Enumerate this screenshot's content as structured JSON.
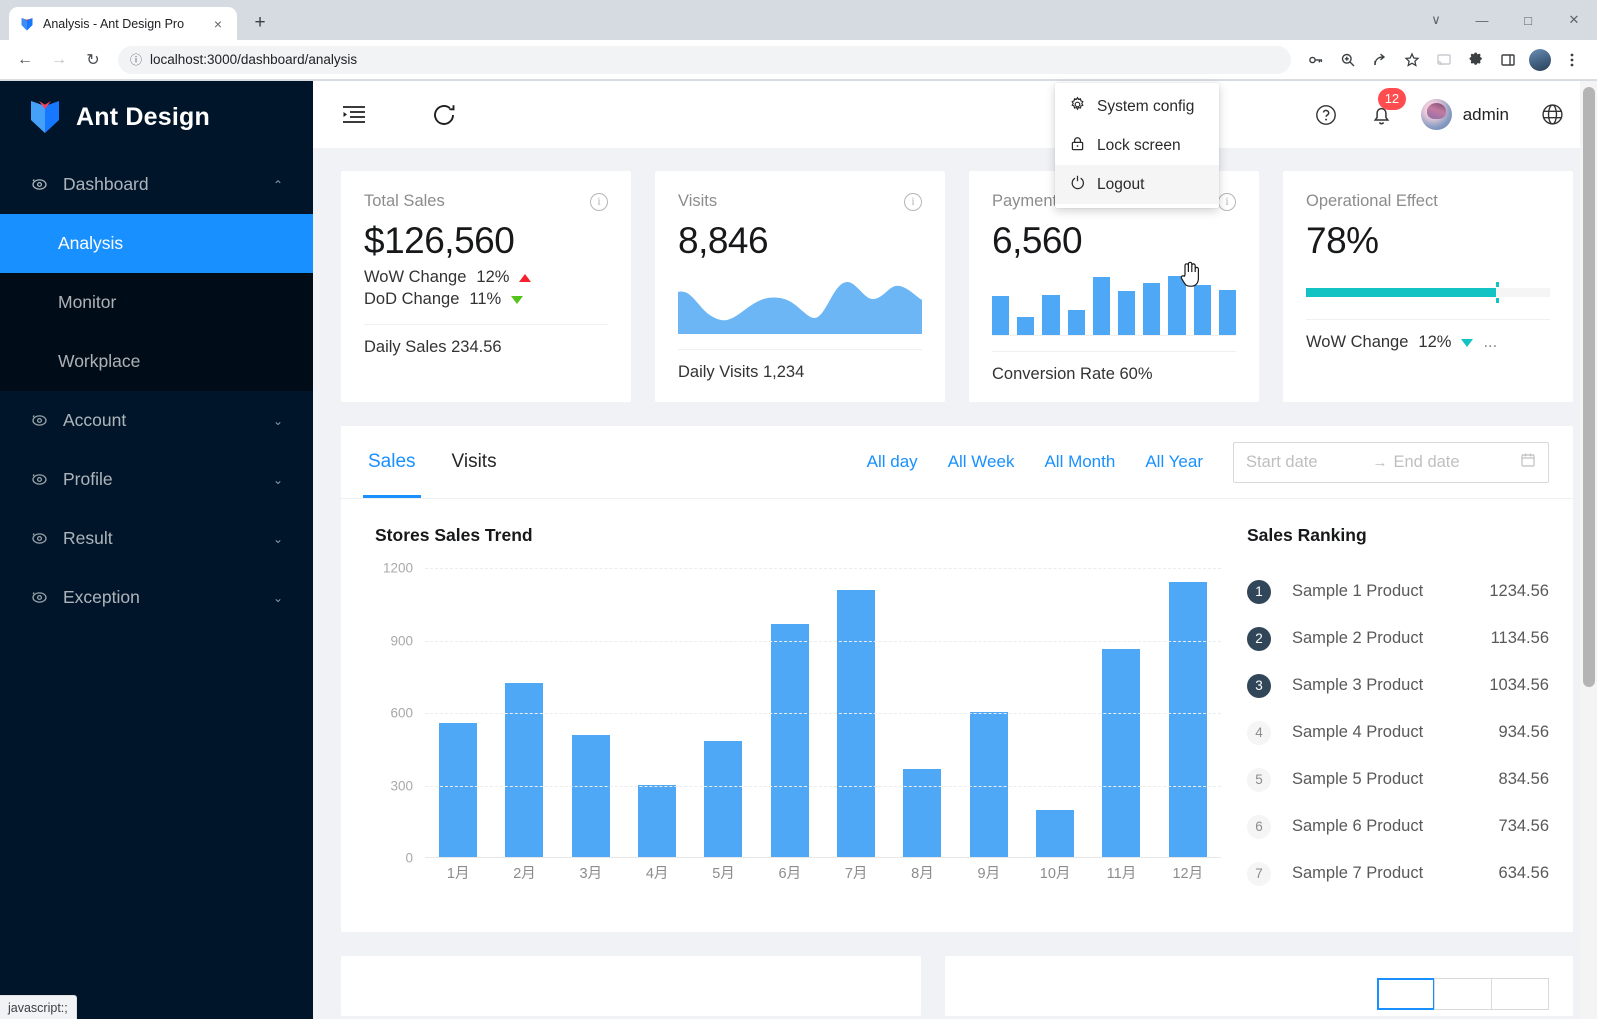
{
  "browser": {
    "tab_title": "Analysis - Ant Design Pro",
    "tab_close": "×",
    "new_tab": "+",
    "window_controls": [
      "∨",
      "—",
      "□",
      "✕"
    ],
    "back": "←",
    "forward": "→",
    "reload": "↻",
    "info_icon": "ⓘ",
    "url": "localhost:3000/dashboard/analysis",
    "toolbar_icons": [
      "key-icon",
      "zoom-icon",
      "share-icon",
      "star-icon",
      "cast-icon",
      "extensions-icon",
      "sidepanel-icon",
      "profile-avatar",
      "chrome-menu-icon"
    ],
    "status_text": "javascript:;"
  },
  "sidebar": {
    "brand": "Ant Design",
    "items": [
      {
        "label": "Dashboard",
        "icon": "eye-icon",
        "caret": "⌃",
        "expanded": true
      },
      {
        "label": "Account",
        "icon": "eye-icon",
        "caret": "⌄",
        "expanded": false
      },
      {
        "label": "Profile",
        "icon": "eye-icon",
        "caret": "⌄",
        "expanded": false
      },
      {
        "label": "Result",
        "icon": "eye-icon",
        "caret": "⌄",
        "expanded": false
      },
      {
        "label": "Exception",
        "icon": "eye-icon",
        "caret": "⌄",
        "expanded": false
      }
    ],
    "submenu": [
      {
        "label": "Analysis",
        "active": true
      },
      {
        "label": "Monitor",
        "active": false
      },
      {
        "label": "Workplace",
        "active": false
      }
    ],
    "active_color": "#1890ff",
    "bg_color": "#001529"
  },
  "header": {
    "menu_fold_icon": "menu-fold-icon",
    "refresh_icon": "refresh-icon",
    "help_icon": "question-circle-icon",
    "bell_icon": "bell-icon",
    "notification_count": "12",
    "notification_color": "#ff4d4f",
    "user_name": "admin",
    "globe_icon": "globe-icon"
  },
  "dropdown": {
    "items": [
      {
        "label": "System config",
        "icon": "gear-icon",
        "hover": false
      },
      {
        "label": "Lock screen",
        "icon": "lock-icon",
        "hover": false
      },
      {
        "label": "Logout",
        "icon": "logout-icon",
        "hover": true
      }
    ]
  },
  "cards": [
    {
      "title": "Total Sales",
      "value": "$126,560",
      "trends": [
        {
          "label": "WoW Change",
          "value": "12%",
          "dir": "up"
        },
        {
          "label": "DoD Change",
          "value": "11%",
          "dir": "down"
        }
      ],
      "footer": "Daily Sales 234.56",
      "visual": "none"
    },
    {
      "title": "Visits",
      "value": "8,846",
      "footer": "Daily Visits 1,234",
      "visual": "area"
    },
    {
      "title": "Payments",
      "value": "6,560",
      "footer": "Conversion Rate 60%",
      "visual": "bars"
    },
    {
      "title": "Operational Effect",
      "value": "78%",
      "footer": "WoW Change",
      "footer_value": "12%",
      "footer_dir": "down",
      "footer_more": "...",
      "visual": "progress",
      "progress": 78,
      "progress_color": "#13c2c2"
    }
  ],
  "panel": {
    "tabs": [
      {
        "label": "Sales",
        "active": true
      },
      {
        "label": "Visits",
        "active": false
      }
    ],
    "quick_links": [
      "All day",
      "All Week",
      "All Month",
      "All Year"
    ],
    "date_start_placeholder": "Start date",
    "date_end_placeholder": "End date",
    "date_sep": "→",
    "calendar_icon": "calendar-icon",
    "chart_heading": "Stores Sales Trend",
    "rank_heading": "Sales Ranking",
    "ranking": [
      {
        "rank": "1",
        "name": "Sample 1 Product",
        "value": "1234.56"
      },
      {
        "rank": "2",
        "name": "Sample 2 Product",
        "value": "1134.56"
      },
      {
        "rank": "3",
        "name": "Sample 3 Product",
        "value": "1034.56"
      },
      {
        "rank": "4",
        "name": "Sample 4 Product",
        "value": "934.56"
      },
      {
        "rank": "5",
        "name": "Sample 5 Product",
        "value": "834.56"
      },
      {
        "rank": "6",
        "name": "Sample 6 Product",
        "value": "734.56"
      },
      {
        "rank": "7",
        "name": "Sample 7 Product",
        "value": "634.56"
      }
    ]
  },
  "chart_data": {
    "type": "bar",
    "title": "Stores Sales Trend",
    "categories": [
      "1月",
      "2月",
      "3月",
      "4月",
      "5月",
      "6月",
      "7月",
      "8月",
      "9月",
      "10月",
      "11月",
      "12月"
    ],
    "values": [
      555,
      720,
      505,
      297,
      480,
      965,
      1105,
      365,
      600,
      195,
      860,
      1140
    ],
    "xlabel": "",
    "ylabel": "",
    "ylim": [
      0,
      1200
    ],
    "yticks": [
      0,
      300,
      600,
      900,
      1200
    ],
    "grid": true,
    "bar_color": "#4ea8f5",
    "legend": "none"
  },
  "mini_charts": {
    "visits_area": {
      "type": "area",
      "values": [
        62,
        30,
        16,
        20,
        38,
        52,
        50,
        36,
        20,
        24,
        74,
        58,
        64,
        80,
        70,
        44
      ],
      "color": "#6cb6f5"
    },
    "payments_bars": {
      "type": "bar",
      "values": [
        62,
        28,
        64,
        40,
        92,
        70,
        82,
        94,
        80,
        72
      ],
      "color": "#4ea8f5"
    }
  }
}
